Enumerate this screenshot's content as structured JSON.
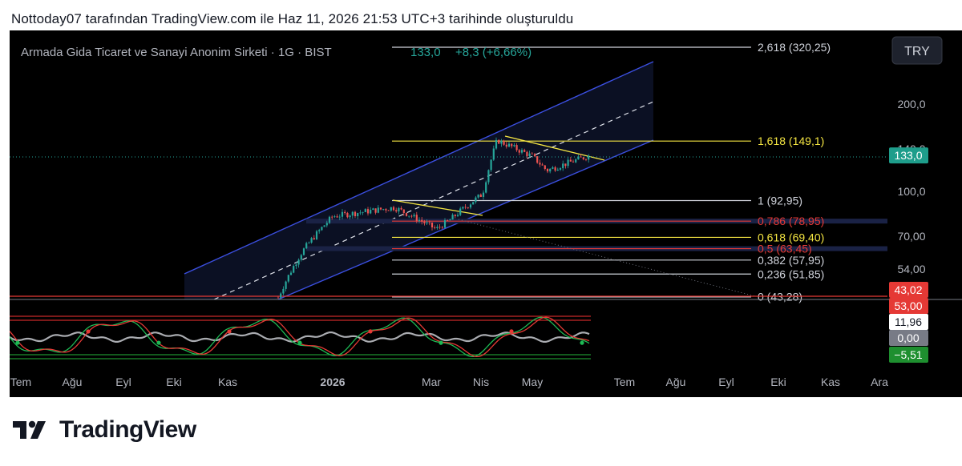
{
  "header": {
    "text": "Nottoday07 tarafından TradingView.com ile Haz 11, 2026 21:53 UTC+3 tarihinde oluşturuldu"
  },
  "legend": {
    "symbol": "Armada Gida Ticaret ve Sanayi Anonim Sirketi · 1G · BIST",
    "price": "133,0",
    "change": "+8,3 (+6,66%)"
  },
  "currency_button": "TRY",
  "footer": {
    "wordmark": "TradingView"
  },
  "colors": {
    "up": "#26a69a",
    "down": "#ef5350",
    "channel": "#3b4fe0",
    "fib_yellow": "#f5e642",
    "fib_red": "#e53935",
    "fib_white": "#d1d4dc",
    "osc_green": "#1e8f2f",
    "osc_red": "#c62828"
  },
  "chart_data": {
    "type": "candlestick",
    "price_scale": {
      "ticks": [
        "200,0",
        "140,0",
        "100,0",
        "70,00",
        "54,00"
      ],
      "price_label": "133,0"
    },
    "x_ticks": [
      "Tem",
      "Ağu",
      "Eyl",
      "Eki",
      "Kas",
      "2026",
      "Mar",
      "Nis",
      "May",
      "Tem",
      "Ağu",
      "Eyl",
      "Eki",
      "Kas",
      "Ara"
    ],
    "fib_levels": [
      {
        "ratio": "2,618",
        "label": "2,618 (320,25)",
        "price": 320.25,
        "color": "white"
      },
      {
        "ratio": "1,618",
        "label": "1,618 (149,1)",
        "price": 149.1,
        "color": "yellow"
      },
      {
        "ratio": "1",
        "label": "1 (92,95)",
        "price": 92.95,
        "color": "white"
      },
      {
        "ratio": "0,786",
        "label": "0,786 (78,95)",
        "price": 78.95,
        "color": "red"
      },
      {
        "ratio": "0,618",
        "label": "0,618 (69,40)",
        "price": 69.4,
        "color": "yellow"
      },
      {
        "ratio": "0,5",
        "label": "0,5 (63,45)",
        "price": 63.45,
        "color": "red"
      },
      {
        "ratio": "0,382",
        "label": "0,382 (57,95)",
        "price": 57.95,
        "color": "white"
      },
      {
        "ratio": "0,236",
        "label": "0,236 (51,85)",
        "price": 51.85,
        "color": "white"
      },
      {
        "ratio": "0",
        "label": "0 (43,28)",
        "price": 43.28,
        "color": "white"
      }
    ],
    "price_path": [
      [
        "Kas",
        43
      ],
      [
        "Ara",
        62
      ],
      [
        "2026",
        82
      ],
      [
        "Şub",
        88
      ],
      [
        "Mar",
        74
      ],
      [
        "Mar",
        80
      ],
      [
        "Nis",
        98
      ],
      [
        "Nis",
        150
      ],
      [
        "May",
        132
      ],
      [
        "May",
        118
      ],
      [
        "Haz",
        133
      ]
    ],
    "oscillator": {
      "labels": [
        "43,02",
        "53,00",
        "11,96",
        "0,00",
        "−5,51"
      ],
      "label_colors": [
        "#e53935",
        "#e53935",
        "#ffffff",
        "#8a8d96",
        "#1e8f2f"
      ]
    }
  }
}
